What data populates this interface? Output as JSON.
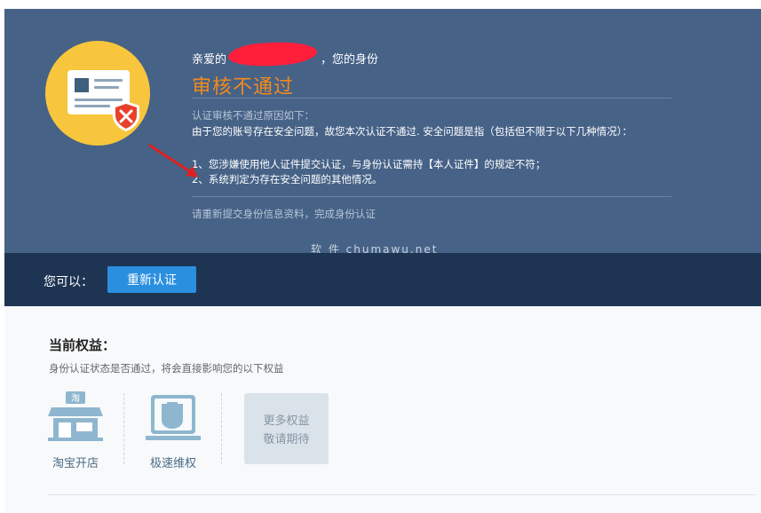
{
  "header": {
    "greeting_prefix": "亲爱的",
    "greeting_suffix": "，您的身份",
    "status_title": "审核不通过",
    "reason_heading": "认证审核不通过原因如下：",
    "reason_intro": "由于您的账号存在安全问题，故您本次认证不通过. 安全问题是指（包括但不限于以下几种情况）：",
    "reasons": [
      "1、您涉嫌使用他人证件提交认证，与身份认证需持【本人证件】的规定不符；",
      "2、系统判定为存在安全问题的其他情况。"
    ],
    "resubmit_hint": "请重新提交身份信息资料，完成身份认证",
    "watermark": "软 件 chumawu.net"
  },
  "action_bar": {
    "label": "您可以：",
    "reverify_button": "重新认证"
  },
  "rights": {
    "title": "当前权益：",
    "subtitle": "身份认证状态是否通过，将会直接影响您的以下权益",
    "tiles": [
      {
        "icon": "shop-icon",
        "label": "淘宝开店",
        "icon_text": "淘"
      },
      {
        "icon": "fist-icon",
        "label": "极速维权"
      }
    ],
    "more_line1": "更多权益",
    "more_line2": "敬请期待"
  },
  "colors": {
    "header_bg": "#466287",
    "action_bar_bg": "#1d3453",
    "accent_orange": "#f28a1c",
    "button_blue": "#2b8fe0",
    "badge_yellow": "#f7c63d",
    "shield_red": "#e8402c",
    "redaction_red": "#ff1f3a"
  }
}
